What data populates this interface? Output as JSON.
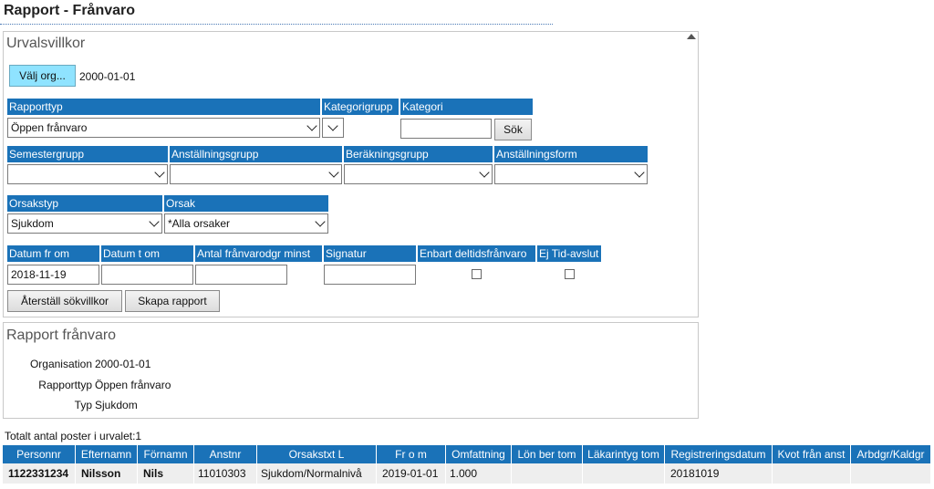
{
  "page": {
    "title": "Rapport - Frånvaro"
  },
  "criteria": {
    "title": "Urvalsvillkor",
    "org_button": "Välj org...",
    "org_value": "2000-01-01",
    "labels": {
      "rapporttyp": "Rapporttyp",
      "kategorigrupp": "Kategorigrupp",
      "kategori": "Kategori",
      "semestergrupp": "Semestergrupp",
      "anstallningsgrupp": "Anställningsgrupp",
      "berakningsgrupp": "Beräkningsgrupp",
      "anstallningsform": "Anställningsform",
      "orsakstyp": "Orsakstyp",
      "orsak": "Orsak",
      "datum_from": "Datum fr om",
      "datum_tom": "Datum t om",
      "antal": "Antal frånvarodgr minst",
      "signatur": "Signatur",
      "deltid": "Enbart deltidsfrånvaro",
      "ejtid": "Ej Tid-avslut"
    },
    "values": {
      "rapporttyp": "Öppen frånvaro",
      "kategorigrupp": "",
      "kategori": "",
      "semestergrupp": "",
      "anstallningsgrupp": "",
      "berakningsgrupp": "",
      "anstallningsform": "",
      "orsakstyp": "Sjukdom",
      "orsak": "*Alla orsaker",
      "datum_from": "2018-11-19",
      "datum_tom": "",
      "antal": "",
      "signatur": "",
      "deltid_checked": false,
      "ejtid_checked": false
    },
    "search_button": "Sök",
    "reset_button": "Återställ sökvillkor",
    "create_button": "Skapa rapport"
  },
  "report": {
    "title": "Rapport frånvaro",
    "rows": [
      {
        "label": "Organisation",
        "value": "2000-01-01"
      },
      {
        "label": "Rapporttyp",
        "value": "Öppen frånvaro"
      },
      {
        "label": "Typ",
        "value": "Sjukdom"
      }
    ]
  },
  "results": {
    "total_text": "Totalt antal poster i urvalet:1",
    "columns": [
      "Personnr",
      "Efternamn",
      "Förnamn",
      "Anstnr",
      "Orsakstxt L",
      "Fr o m",
      "Omfattning",
      "Lön ber tom",
      "Läkarintyg tom",
      "Registreringsdatum",
      "Kvot från anst",
      "Arbdgr/Kaldgr"
    ],
    "rows": [
      [
        "1122331234",
        "Nilsson",
        "Nils",
        "11010303",
        "Sjukdom/Normalnivå",
        "2019-01-01",
        "1.000",
        "",
        "",
        "20181019",
        "",
        ""
      ]
    ]
  },
  "colors": {
    "header_blue": "#1a72b8",
    "org_button": "#8fe3ff"
  }
}
